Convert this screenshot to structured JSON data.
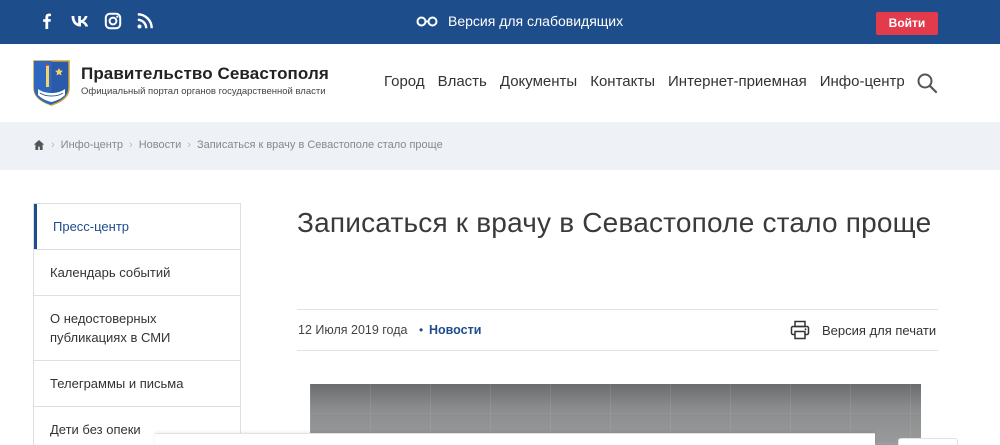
{
  "topbar": {
    "social_icons": [
      "facebook-icon",
      "vk-icon",
      "instagram-icon",
      "rss-icon"
    ],
    "accessibility_label": "Версия для слабовидящих",
    "login_label": "Войти",
    "colors": {
      "background": "#1e4d8c",
      "login_button": "#e33b4c"
    }
  },
  "header": {
    "brand_title": "Правительство Севастополя",
    "brand_subtitle": "Официальный портал органов государственной власти",
    "nav": [
      "Город",
      "Власть",
      "Документы",
      "Контакты",
      "Интернет-приемная",
      "Инфо-центр"
    ]
  },
  "breadcrumb": {
    "items": [
      "Инфо-центр",
      "Новости",
      "Записаться к врачу в Севастополе стало проще"
    ]
  },
  "sidebar": {
    "items": [
      {
        "label": "Пресс-центр",
        "active": true
      },
      {
        "label": "Календарь событий",
        "active": false
      },
      {
        "label": "О недостоверных публикациях в СМИ",
        "active": false
      },
      {
        "label": "Телеграммы и письма",
        "active": false
      },
      {
        "label": "Дети без опеки",
        "active": false
      }
    ]
  },
  "article": {
    "title": "Записаться к врачу в Севастополе стало проще",
    "date": "12 Июля 2019 года",
    "category": "Новости",
    "print_label": "Версия для печати"
  }
}
